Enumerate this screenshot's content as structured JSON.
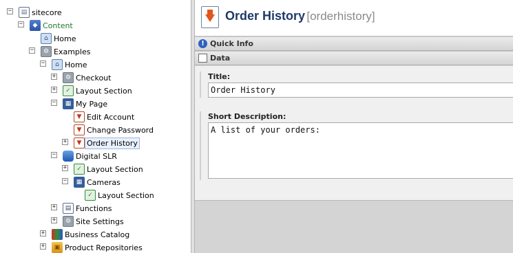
{
  "tree": {
    "items": [
      {
        "label": "sitecore",
        "icon": "document-icon",
        "expander": "−"
      },
      {
        "label": "Content",
        "icon": "content-icon",
        "expander": "−"
      },
      {
        "label": "Home",
        "icon": "home-icon",
        "expander": ""
      },
      {
        "label": "Examples",
        "icon": "gear-icon",
        "expander": "−"
      },
      {
        "label": "Home",
        "icon": "home-icon",
        "expander": "−"
      },
      {
        "label": "Checkout",
        "icon": "gear-icon",
        "expander": "+"
      },
      {
        "label": "Layout Section",
        "icon": "layout-icon",
        "expander": "+"
      },
      {
        "label": "My Page",
        "icon": "grid-icon",
        "expander": "−"
      },
      {
        "label": "Edit Account",
        "icon": "page-icon",
        "expander": ""
      },
      {
        "label": "Change Password",
        "icon": "page-icon",
        "expander": ""
      },
      {
        "label": "Order History",
        "icon": "page-icon",
        "expander": "+"
      },
      {
        "label": "Digital SLR",
        "icon": "database-icon",
        "expander": "−"
      },
      {
        "label": "Layout Section",
        "icon": "layout-icon",
        "expander": "+"
      },
      {
        "label": "Cameras",
        "icon": "grid-icon",
        "expander": "−"
      },
      {
        "label": "Layout Section",
        "icon": "layout-icon",
        "expander": ""
      },
      {
        "label": "Functions",
        "icon": "functions-icon",
        "expander": "+"
      },
      {
        "label": "Site Settings",
        "icon": "settings-icon",
        "expander": "+"
      },
      {
        "label": "Business Catalog",
        "icon": "catalog-icon",
        "expander": "+"
      },
      {
        "label": "Product Repositories",
        "icon": "box-icon",
        "expander": "+"
      }
    ]
  },
  "editor": {
    "title": "Order History",
    "item_key": "- [orderhistory]",
    "sections": {
      "quick_info": "Quick Info",
      "data": "Data"
    },
    "fields": {
      "title_label": "Title:",
      "title_value": "Order History",
      "short_desc_label": "Short Description:",
      "short_desc_value": "A list of your orders:"
    }
  },
  "colors": {
    "title": "#1f3a68",
    "item_key": "#8a8a8a",
    "selection": "#e8f0fb"
  }
}
